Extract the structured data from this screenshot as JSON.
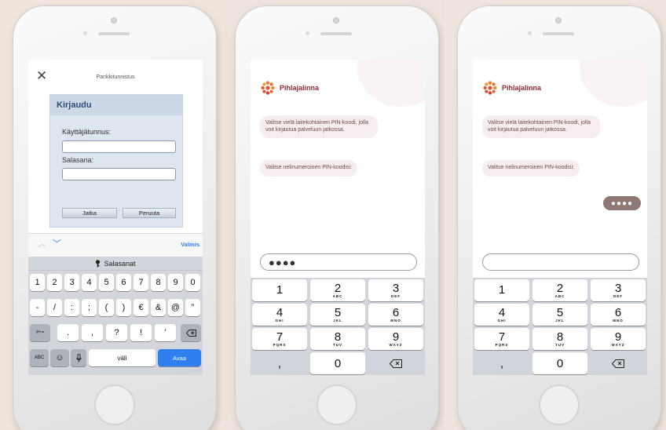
{
  "colors": {
    "brand": "#8e2a33",
    "ios_blue": "#2f7ff0",
    "login_header": "#2c4d7e",
    "user_bubble": "#8f7773"
  },
  "phone1": {
    "nav_title": "Pankkitunnistus",
    "close_icon": "close-icon",
    "login": {
      "title": "Kirjaudu",
      "username_label": "Käyttäjätunnus:",
      "username_value": "",
      "password_label": "Salasana:",
      "password_value": "",
      "continue_label": "Jatka",
      "cancel_label": "Peruuta"
    },
    "toolbar": {
      "done_label": "Valmis",
      "prev_icon": "chevron-up-icon",
      "next_icon": "chevron-down-icon"
    },
    "keyboard": {
      "passwords_label": "Salasanat",
      "row1": [
        "1",
        "2",
        "3",
        "4",
        "5",
        "6",
        "7",
        "8",
        "9",
        "0"
      ],
      "row2": [
        "-",
        "/",
        ":",
        ";",
        "(",
        ")",
        "€",
        "&",
        "@",
        "”"
      ],
      "symbols_key": "#+=",
      "row3": [
        ".",
        ",",
        "?",
        "!",
        "’"
      ],
      "abc_key": "ABC",
      "space_label": "väli",
      "go_label": "Avaa"
    }
  },
  "phone2": {
    "brand": "Pihlajalinna",
    "messages": [
      "Valitse vielä laitekohtainen PIN-koodi, jolla voit kirjautua palveluun jatkossa.",
      "Valitse nelinumeroinen PIN-koodisi:"
    ],
    "input_value": "●●●●"
  },
  "phone3": {
    "brand": "Pihlajalinna",
    "messages": [
      "Valitse vielä laitekohtainen PIN-koodi, jolla voit kirjautua palveluun jatkossa.",
      "Valitse nelinumeroinen PIN-koodisi:"
    ],
    "user_reply": "●●●●",
    "input_value": ""
  },
  "numpad_keys": [
    {
      "digit": "1",
      "letters": ""
    },
    {
      "digit": "2",
      "letters": "ABC"
    },
    {
      "digit": "3",
      "letters": "DEF"
    },
    {
      "digit": "4",
      "letters": "GHI"
    },
    {
      "digit": "5",
      "letters": "JKL"
    },
    {
      "digit": "6",
      "letters": "MNO"
    },
    {
      "digit": "7",
      "letters": "PQRS"
    },
    {
      "digit": "8",
      "letters": "TUV"
    },
    {
      "digit": "9",
      "letters": "WXYZ"
    },
    {
      "digit": ",",
      "letters": ""
    },
    {
      "digit": "0",
      "letters": ""
    },
    {
      "digit": "",
      "letters": "",
      "icon": "backspace-icon"
    }
  ]
}
